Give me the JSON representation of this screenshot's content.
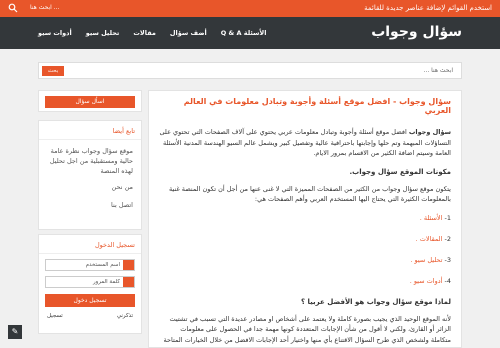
{
  "topbar": {
    "news": "استخدم القوائم لإضافة عناصر جديدة للقائمة",
    "search_hint": "ابحث هنا ..."
  },
  "header": {
    "logo": "سؤال وجواب"
  },
  "nav": [
    {
      "label": "الأسئلة Q & A"
    },
    {
      "label": "أضف سؤال"
    },
    {
      "label": "مقالات"
    },
    {
      "label": "تحليل سيو"
    },
    {
      "label": "أدوات سيو"
    }
  ],
  "search": {
    "placeholder": "ابحث هنا ...",
    "button": "بحث"
  },
  "sidebar": {
    "ask_button": "اسأل سؤال",
    "follow_title": "تابع أيضا",
    "follow_text": "موقع سؤال وجواب نظرة عامة حالية ومستقبلية من اجل تحليل لهذه المنصة",
    "links": [
      "من نحن",
      "اتصل بنا"
    ],
    "login_title": "تسجيل الدخول",
    "username_placeholder": "اسم المستخدم",
    "password_placeholder": "كلمة المرور",
    "login_button": "تسجيل دخول",
    "remember": "تذكرني",
    "register": "تسجيل"
  },
  "article": {
    "title": "سؤال وجواب - افضل موقع أسئلة وأجوبة وتبادل معلومات في العالم العربي",
    "intro_bold": "سؤال وجواب",
    "intro": " افضل موقع أسئلة وأجوبة وتبادل معلومات عربي يحتوي على آلاف الصفحات التي تحتوي على التساؤلات المبهمة وتم حلها وإجابتها باحترافية عالية وتفصيل كبير ويشمل عالم السيو الهندسة المدنية الأسئلة العامة وسيتم اضافة الكثير من الاقسام بمرور الايام.",
    "sec1": "مكونات الموقع سؤال وجواب.",
    "sec1_text": "يتكون موقع سؤال وجواب من الكثير من الصفحات المميزة التي لا غنى عنها من أجل أن تكون المنصة غنية بالمعلومات الكثيرة التي يحتاج اليها المستخدم العربي وأهم الصفحات هي:",
    "items": [
      {
        "num": "1-",
        "label": "الأسئلة ."
      },
      {
        "num": "2-",
        "label": "المقالات ."
      },
      {
        "num": "3-",
        "label": "تحليل سيو ."
      },
      {
        "num": "4-",
        "label": "أدوات سيو ."
      }
    ],
    "sec2": "لماذا موقع سؤال وجواب هو الأفضل عربيا ؟",
    "sec2_text": "لأنه الموقع الوحيد الذي يجيب بصورة كاملة ولا يعتمد على أشخاص او مصادر عديدة التي تسبب في تشتيت الزائر أو القارئ، ولكني لا أقول من شأن الإجابات المتعددة كونها مهمة جدا في الحصول على معلومات متكاملة ولشخص الذي طرح السؤال الاقتناع بأي منها واختيار أحد الإجابات الافضل من خلال الخيارات المتاحة له."
  },
  "colors": {
    "accent": "#e8562a",
    "header": "#33373a"
  }
}
